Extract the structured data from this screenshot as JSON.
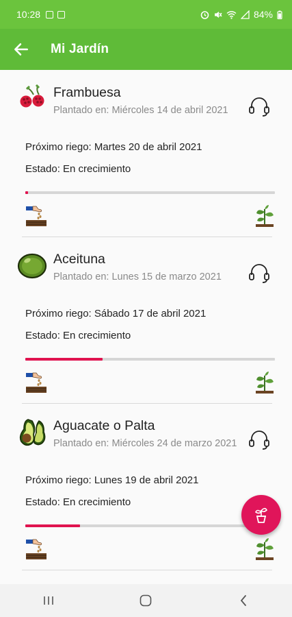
{
  "status_bar": {
    "time": "10:28",
    "battery": "84%"
  },
  "app_bar": {
    "title": "Mi Jardín"
  },
  "plants": [
    {
      "name": "Frambuesa",
      "icon": "raspberry-icon",
      "planted": "Plantado en: Miércoles 14 de abril 2021",
      "next_watering": "Próximo riego: Martes 20 de abril 2021",
      "status": "Estado: En crecimiento",
      "progress": 0.01
    },
    {
      "name": "Aceituna",
      "icon": "olive-icon",
      "planted": "Plantado en: Lunes 15 de marzo 2021",
      "next_watering": "Próximo riego: Sábado 17 de abril 2021",
      "status": "Estado: En crecimiento",
      "progress": 0.31
    },
    {
      "name": "Aguacate o Palta",
      "icon": "avocado-icon",
      "planted": "Plantado en: Miércoles 24 de marzo 2021",
      "next_watering": "Próximo riego: Lunes 19 de abril 2021",
      "status": "Estado: En crecimiento",
      "progress": 0.22
    }
  ],
  "colors": {
    "status_bar": "#6bc43d",
    "app_bar": "#5fbb38",
    "progress_fill": "#e0134f",
    "fab": "#e0155a"
  },
  "fab": {
    "icon": "potted-plant-icon"
  }
}
